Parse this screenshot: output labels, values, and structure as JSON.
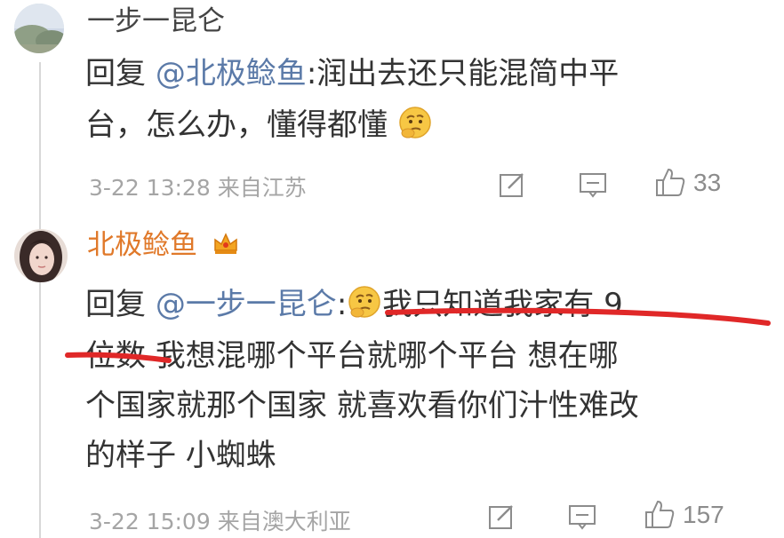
{
  "comments": [
    {
      "username": "一步一昆仑",
      "reply_prefix": "回复 ",
      "mention": "@北极鲶鱼",
      "line1_rest": ":润出去还只能混简中平",
      "line2": "台，怎么办，懂得都懂",
      "time": "3-22 13:28",
      "location": "来自江苏",
      "likes": "33",
      "username_color": "#444444"
    },
    {
      "username": "北极鲶鱼",
      "reply_prefix": "回复 ",
      "mention": "@一步一昆仑",
      "line1_colon": ":",
      "line1_rest": "我只知道我家有 9",
      "line2": "位数 我想混哪个平台就哪个平台 想在哪",
      "line3": "个国家就那个国家 就喜欢看你们汁性难改",
      "line4": "的样子 小蜘蛛",
      "time": "3-22 15:09",
      "location": "来自澳大利亚",
      "likes": "157",
      "username_color": "#e0792a"
    }
  ],
  "icons": [
    "edit-icon",
    "comment-icon",
    "thumbs-up-icon",
    "thinking-emoji-icon",
    "crown-badge-icon"
  ],
  "accent": {
    "mention": "#5b7aa8",
    "underline": "#e02828",
    "username_vip": "#e0792a"
  }
}
